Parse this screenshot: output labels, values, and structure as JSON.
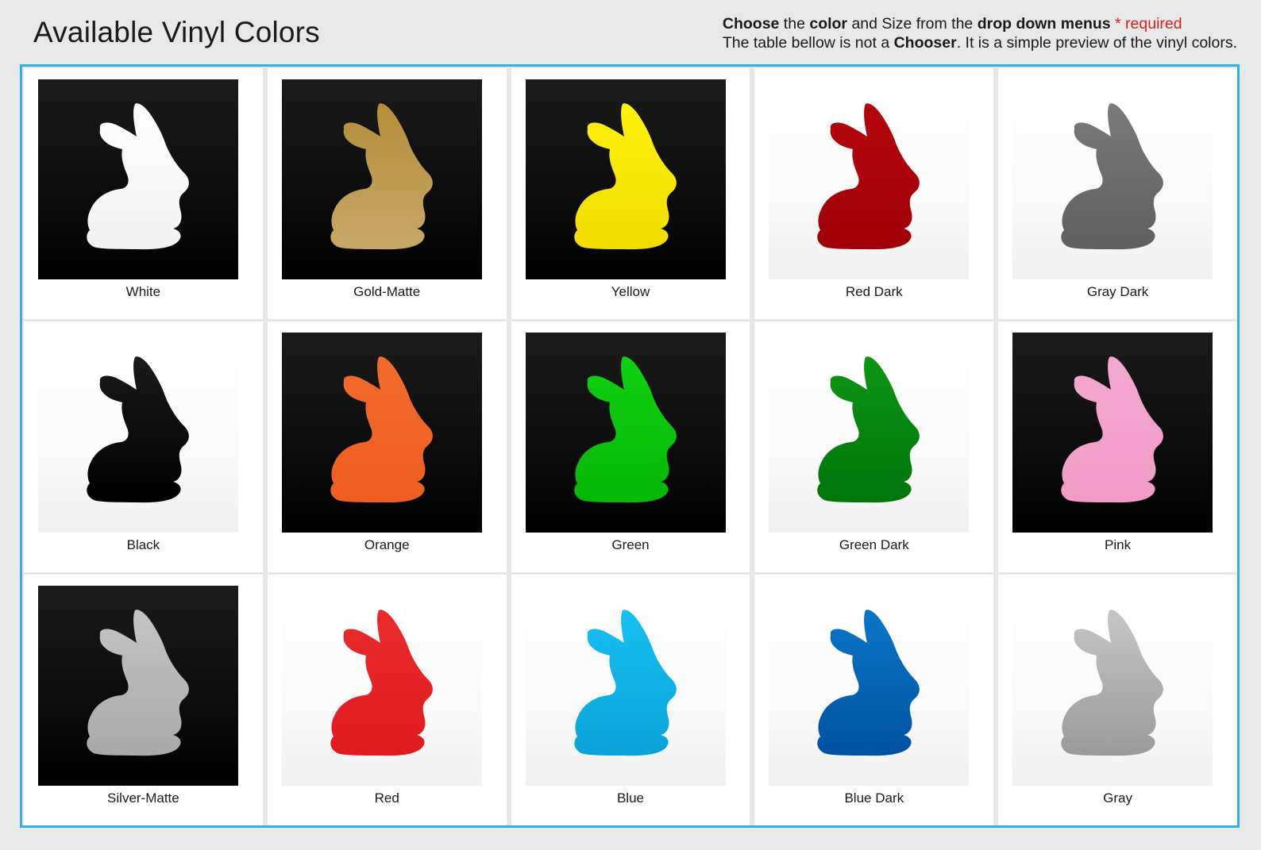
{
  "header": {
    "title": "Available Vinyl Colors",
    "notice_line1": {
      "w1": "Choose",
      "w2": " the ",
      "w3": "color",
      "w4": " and Size from the ",
      "w5": "drop down menus",
      "required": " * required"
    },
    "notice_line2": {
      "t1": "The table bellow is not a ",
      "t2": "Chooser",
      "t3": ". It is a simple preview of the vinyl colors."
    }
  },
  "colors": [
    {
      "label": "White",
      "bg": "dark",
      "top": "#ffffff",
      "bottom": "#f2f2f2"
    },
    {
      "label": "Gold-Matte",
      "bg": "dark",
      "top": "#b58d3a",
      "bottom": "#c7a867"
    },
    {
      "label": "Yellow",
      "bg": "dark",
      "top": "#fff20a",
      "bottom": "#f0dc00"
    },
    {
      "label": "Red Dark",
      "bg": "light",
      "top": "#b3060b",
      "bottom": "#a00008"
    },
    {
      "label": "Gray Dark",
      "bg": "light",
      "top": "#7a7a7a",
      "bottom": "#5f5f5f"
    },
    {
      "label": "Black",
      "bg": "light",
      "top": "#1a1a1a",
      "bottom": "#000000"
    },
    {
      "label": "Orange",
      "bg": "dark",
      "top": "#f36b2c",
      "bottom": "#ee5e20"
    },
    {
      "label": "Green",
      "bg": "dark",
      "top": "#10d010",
      "bottom": "#06b706"
    },
    {
      "label": "Green Dark",
      "bg": "light",
      "top": "#0b9612",
      "bottom": "#00740c"
    },
    {
      "label": "Pink",
      "bg": "dark",
      "top": "#f3a9cf",
      "bottom": "#f19cc6"
    },
    {
      "label": "Silver-Matte",
      "bg": "dark",
      "top": "#c4c4c4",
      "bottom": "#a9a9a9"
    },
    {
      "label": "Red",
      "bg": "light",
      "top": "#ea2b2b",
      "bottom": "#e01a1f"
    },
    {
      "label": "Blue",
      "bg": "light",
      "top": "#16c0f2",
      "bottom": "#0aa3d8"
    },
    {
      "label": "Blue Dark",
      "bg": "light",
      "top": "#0a76c8",
      "bottom": "#0051a0"
    },
    {
      "label": "Gray",
      "bg": "light",
      "top": "#c6c6c6",
      "bottom": "#9a9a9a"
    }
  ]
}
